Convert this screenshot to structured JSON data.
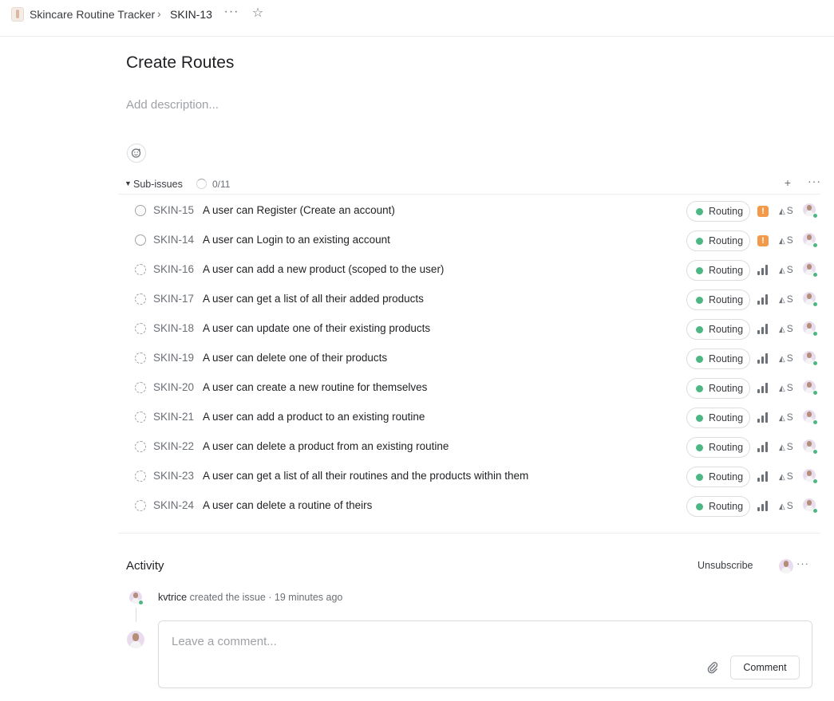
{
  "breadcrumb": {
    "project": "Skincare Routine Tracker",
    "separator": "›",
    "issue_id": "SKIN-13",
    "more": "···",
    "star": "☆"
  },
  "issue": {
    "title": "Create Routes",
    "description_placeholder": "Add description..."
  },
  "sub_issues": {
    "label": "Sub-issues",
    "count": "0/11",
    "add": "+",
    "more": "···",
    "items": [
      {
        "id": "SKIN-15",
        "title": "A user can Register (Create an account)",
        "status": "todo",
        "label": "Routing",
        "priority": "urgent",
        "estimate": "S"
      },
      {
        "id": "SKIN-14",
        "title": "A user can Login to an existing account",
        "status": "todo",
        "label": "Routing",
        "priority": "urgent",
        "estimate": "S"
      },
      {
        "id": "SKIN-16",
        "title": "A user can add a new product (scoped to the user)",
        "status": "backlog",
        "label": "Routing",
        "priority": "high",
        "estimate": "S"
      },
      {
        "id": "SKIN-17",
        "title": "A user can get a list of all their added products",
        "status": "backlog",
        "label": "Routing",
        "priority": "high",
        "estimate": "S"
      },
      {
        "id": "SKIN-18",
        "title": "A user can update one of their existing products",
        "status": "backlog",
        "label": "Routing",
        "priority": "high",
        "estimate": "S"
      },
      {
        "id": "SKIN-19",
        "title": "A user can delete one of their products",
        "status": "backlog",
        "label": "Routing",
        "priority": "high",
        "estimate": "S"
      },
      {
        "id": "SKIN-20",
        "title": "A user can create a new routine for themselves",
        "status": "backlog",
        "label": "Routing",
        "priority": "high",
        "estimate": "S"
      },
      {
        "id": "SKIN-21",
        "title": "A user can add a product to an existing routine",
        "status": "backlog",
        "label": "Routing",
        "priority": "high",
        "estimate": "S"
      },
      {
        "id": "SKIN-22",
        "title": "A user can delete a product from an existing routine",
        "status": "backlog",
        "label": "Routing",
        "priority": "high",
        "estimate": "S"
      },
      {
        "id": "SKIN-23",
        "title": "A user can get a list of all their routines and the products within them",
        "status": "backlog",
        "label": "Routing",
        "priority": "high",
        "estimate": "S"
      },
      {
        "id": "SKIN-24",
        "title": "A user can delete a routine of theirs",
        "status": "backlog",
        "label": "Routing",
        "priority": "high",
        "estimate": "S"
      }
    ]
  },
  "activity": {
    "title": "Activity",
    "unsubscribe": "Unsubscribe",
    "more": "···",
    "event": {
      "user": "kvtrice",
      "action": " created the issue",
      "sep": " · ",
      "time": "19 minutes ago"
    },
    "comment_placeholder": "Leave a comment...",
    "comment_button": "Comment"
  },
  "colors": {
    "label_dot": "#4cb782",
    "urgent": "#f2994a",
    "online": "#4cb782"
  },
  "icons": {
    "project": "project-icon",
    "status_todo": "circle-icon",
    "status_backlog": "dashed-circle-icon",
    "priority_urgent": "exclamation-icon",
    "priority_high": "signal-bars-icon",
    "estimate": "triangle-icon",
    "attach": "paperclip-icon",
    "emoji": "emoji-reaction-icon"
  }
}
